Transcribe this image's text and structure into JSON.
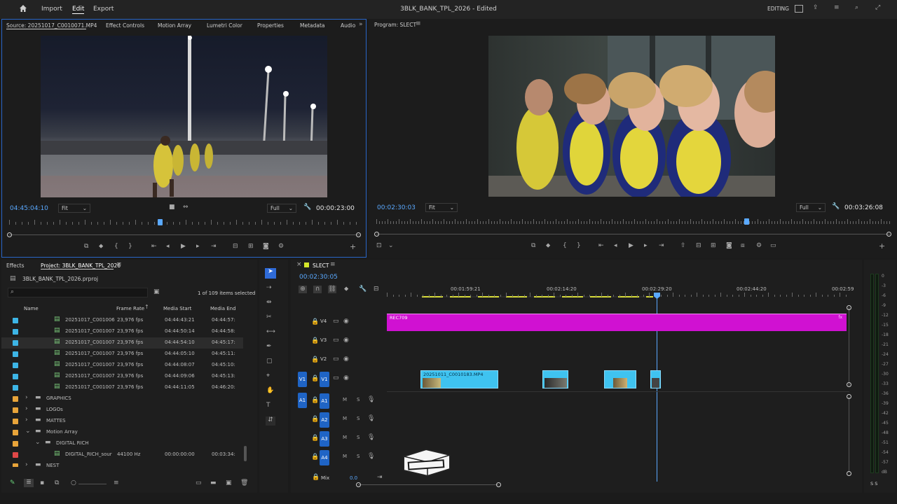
{
  "topbar": {
    "menu": [
      "Import",
      "Edit",
      "Export"
    ],
    "active_menu": "Edit",
    "title": "3BLK_BANK_TPL_2026 - Edited",
    "workspace": "EDITING"
  },
  "source_panel": {
    "tabs": [
      "Source: 20251017_C0010071.MP4",
      "Effect Controls",
      "Motion Array",
      "Lumetri Color",
      "Properties",
      "Metadata",
      "Audio"
    ],
    "timecode_left": "04:45:04:10",
    "fit": "Fit",
    "full": "Full",
    "duration": "00:00:23:00"
  },
  "program_panel": {
    "title": "Program: SLECT",
    "timecode_left": "00:02:30:03",
    "fit": "Fit",
    "full": "Full",
    "duration": "00:03:26:08"
  },
  "project_panel": {
    "tabs": [
      "Effects",
      "Project: 3BLK_BANK_TPL_2026"
    ],
    "project_file": "3BLK_BANK_TPL_2026.prproj",
    "items_selected": "1 of 109 items selected",
    "columns": [
      "Name",
      "Frame Rate",
      "Media Start",
      "Media End"
    ],
    "rows": [
      {
        "name": "20251017_C001006",
        "fps": "23,976 fps",
        "start": "04:44:43:21",
        "end": "04:44:57:2",
        "color": "#3db5e6"
      },
      {
        "name": "20251017_C001007",
        "fps": "23,976 fps",
        "start": "04:44:50:14",
        "end": "04:44:58:1",
        "color": "#3db5e6"
      },
      {
        "name": "20251017_C001007",
        "fps": "23,976 fps",
        "start": "04:44:54:10",
        "end": "04:45:17:0",
        "color": "#3db5e6"
      },
      {
        "name": "20251017_C001007",
        "fps": "23,976 fps",
        "start": "04:44:05:10",
        "end": "04:45:11:0",
        "color": "#3db5e6"
      },
      {
        "name": "20251017_C001007",
        "fps": "23,976 fps",
        "start": "04:44:08:07",
        "end": "04:45:10:0",
        "color": "#3db5e6"
      },
      {
        "name": "20251017_C001007",
        "fps": "23,976 fps",
        "start": "04:44:09:06",
        "end": "04:45:13:0",
        "color": "#3db5e6"
      },
      {
        "name": "20251017_C001007",
        "fps": "23,976 fps",
        "start": "04:44:11:05",
        "end": "04:46:20:0",
        "color": "#3db5e6"
      }
    ],
    "folders": [
      {
        "name": "GRAPHICS",
        "color": "#e8a43a"
      },
      {
        "name": "LOGOs",
        "color": "#e8a43a"
      },
      {
        "name": "MATTES",
        "color": "#e8a43a"
      },
      {
        "name": "Motion Array",
        "color": "#e8a43a"
      },
      {
        "name": "DIGITAL RICH",
        "color": "#e8a43a"
      }
    ],
    "audio_item": {
      "name": "DIGITAL_RICH_sour",
      "rate": "44100 Hz",
      "start": "00:00:00:00",
      "end": "00:03:34:1",
      "color": "#e04848"
    },
    "last_folder": "NEST"
  },
  "timeline": {
    "sequence": "SLECT",
    "timecode": "00:02:30:05",
    "ruler_labels": [
      "00:01:59:21",
      "00:02:14:20",
      "00:02:29:20",
      "00:02:44:20",
      "00:02:59"
    ],
    "video_tracks": [
      "V4",
      "V3",
      "V2",
      "V1"
    ],
    "audio_tracks": [
      "A1",
      "A2",
      "A3",
      "A4"
    ],
    "adjustment_clip": "REC709",
    "clip_name": "20251011_C0010183.MP4",
    "mix_label": "Mix",
    "mix_value": "0.0",
    "source_patch_v": "V1",
    "source_patch_a": "A1"
  },
  "meter": {
    "scale": [
      "0",
      "-3",
      "-6",
      "-9",
      "-12",
      "-15",
      "-18",
      "-21",
      "-24",
      "-27",
      "-30",
      "-33",
      "-36",
      "-39",
      "-42",
      "-45",
      "-48",
      "-51",
      "-54",
      "-57",
      "dB"
    ],
    "solo": "S S"
  }
}
